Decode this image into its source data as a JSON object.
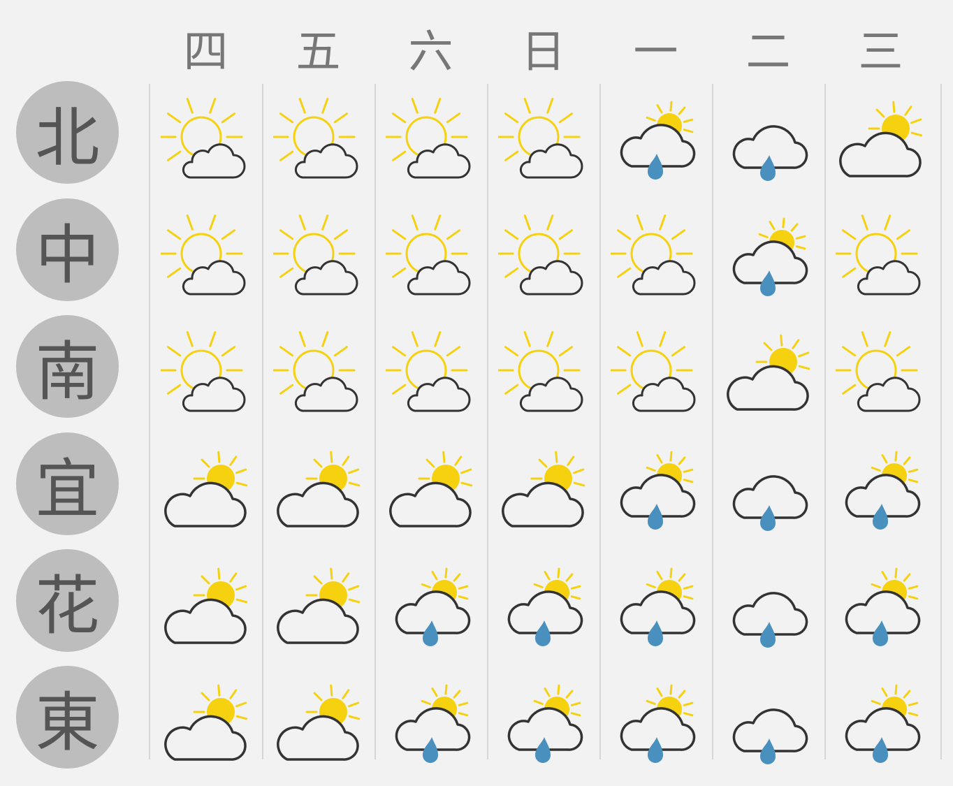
{
  "days": [
    "四",
    "五",
    "六",
    "日",
    "一",
    "二",
    "三"
  ],
  "regions": [
    {
      "name": "北",
      "weather": [
        "sunny-cloudy",
        "sunny-cloudy",
        "sunny-cloudy",
        "sunny-cloudy",
        "cloudy-rain-sun",
        "cloudy-rain",
        "cloudy-sun"
      ]
    },
    {
      "name": "中",
      "weather": [
        "sunny-cloudy",
        "sunny-cloudy",
        "sunny-cloudy",
        "sunny-cloudy",
        "sunny-cloudy",
        "cloudy-rain-sun",
        "sunny-cloudy"
      ]
    },
    {
      "name": "南",
      "weather": [
        "sunny-cloudy",
        "sunny-cloudy",
        "sunny-cloudy",
        "sunny-cloudy",
        "sunny-cloudy",
        "cloudy-sun",
        "sunny-cloudy"
      ]
    },
    {
      "name": "宜",
      "weather": [
        "cloudy-sun",
        "cloudy-sun",
        "cloudy-sun",
        "cloudy-sun",
        "cloudy-rain-sun",
        "cloudy-rain",
        "cloudy-rain-sun"
      ]
    },
    {
      "name": "花",
      "weather": [
        "cloudy-sun",
        "cloudy-sun",
        "cloudy-rain-sun",
        "cloudy-rain-sun",
        "cloudy-rain-sun",
        "cloudy-rain",
        "cloudy-rain-sun"
      ]
    },
    {
      "name": "東",
      "weather": [
        "cloudy-sun",
        "cloudy-sun",
        "cloudy-rain-sun",
        "cloudy-rain-sun",
        "cloudy-rain-sun",
        "cloudy-rain",
        "cloudy-rain-sun"
      ]
    }
  ],
  "colors": {
    "sun": "#f5d10f",
    "cloud_stroke": "#333333",
    "rain": "#4a90be",
    "region_circle": "#bdbdbd"
  }
}
